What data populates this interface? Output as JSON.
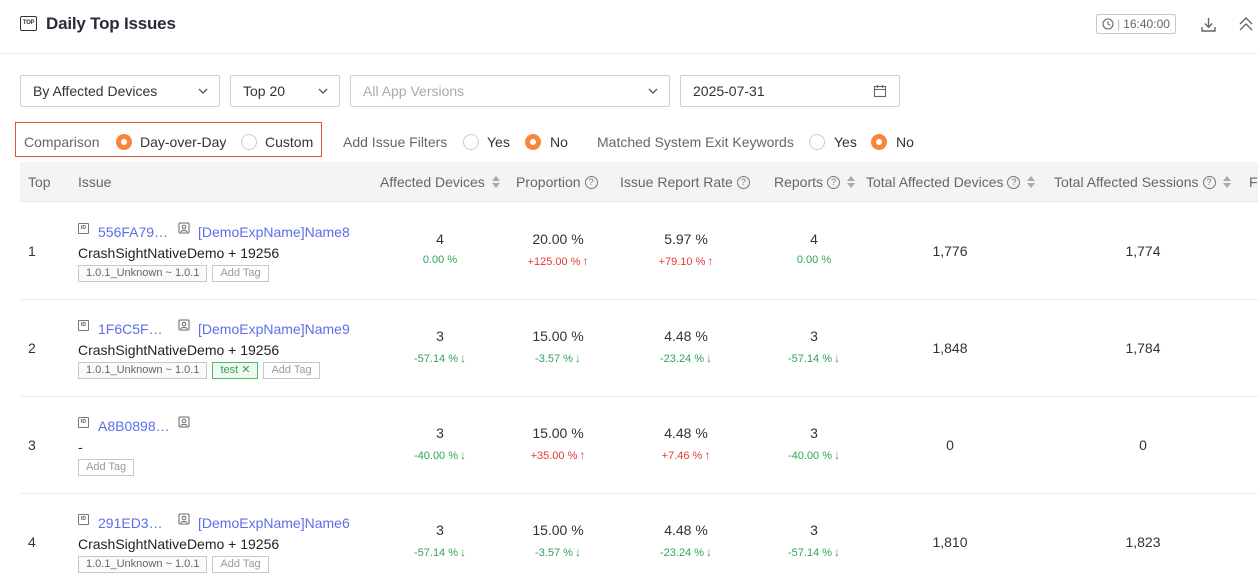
{
  "header": {
    "title": "Daily Top Issues",
    "time": "16:40:00",
    "icons": [
      "top-icon",
      "history-icon",
      "download-icon",
      "collapse-icon"
    ]
  },
  "filters": {
    "sort_by": "By Affected Devices",
    "top_n": "Top 20",
    "versions_placeholder": "All App Versions",
    "date": "2025-07-31"
  },
  "options": {
    "comparison_label": "Comparison",
    "day_over_day": "Day-over-Day",
    "custom": "Custom",
    "add_filters_label": "Add Issue Filters",
    "matched_label": "Matched System Exit Keywords",
    "yes": "Yes",
    "no": "No",
    "comparison_selected": "Day-over-Day",
    "add_filters_selected": "No",
    "matched_selected": "No"
  },
  "colors": {
    "accent": "#f6863b",
    "link": "#5c6ee8",
    "up": "#e53935",
    "down": "#2ea55a",
    "highlight_border": "#e0542f"
  },
  "table": {
    "columns": [
      "Top",
      "Issue",
      "Affected Devices",
      "Proportion",
      "Issue Report Rate",
      "Reports",
      "Total Affected Devices",
      "Total Affected Sessions",
      "F"
    ],
    "rows": [
      {
        "rank": "1",
        "issue_id": "556FA79…",
        "exp_name": "[DemoExpName]Name8",
        "sub": "CrashSightNativeDemo + 19256",
        "tags": [
          "1.0.1_Unknown ~ 1.0.1"
        ],
        "green_tag": "",
        "add_tag": "Add Tag",
        "affected": "4",
        "affected_delta": "0.00 %",
        "affected_trend": "flat",
        "proportion": "20.00 %",
        "proportion_delta": "+125.00 %",
        "proportion_trend": "up",
        "rate": "5.97 %",
        "rate_delta": "+79.10 %",
        "rate_trend": "up",
        "reports": "4",
        "reports_delta": "0.00 %",
        "reports_trend": "flat",
        "total_devices": "1,776",
        "total_sessions": "1,774"
      },
      {
        "rank": "2",
        "issue_id": "1F6C5F…",
        "exp_name": "[DemoExpName]Name9",
        "sub": "CrashSightNativeDemo + 19256",
        "tags": [
          "1.0.1_Unknown ~ 1.0.1"
        ],
        "green_tag": "test",
        "add_tag": "Add Tag",
        "affected": "3",
        "affected_delta": "-57.14 %",
        "affected_trend": "down",
        "proportion": "15.00 %",
        "proportion_delta": "-3.57 %",
        "proportion_trend": "down",
        "rate": "4.48 %",
        "rate_delta": "-23.24 %",
        "rate_trend": "down",
        "reports": "3",
        "reports_delta": "-57.14 %",
        "reports_trend": "down",
        "total_devices": "1,848",
        "total_sessions": "1,784"
      },
      {
        "rank": "3",
        "issue_id": "A8B0898…",
        "exp_name": "",
        "sub": "-",
        "tags": [],
        "green_tag": "",
        "add_tag": "Add Tag",
        "affected": "3",
        "affected_delta": "-40.00 %",
        "affected_trend": "down",
        "proportion": "15.00 %",
        "proportion_delta": "+35.00 %",
        "proportion_trend": "up",
        "rate": "4.48 %",
        "rate_delta": "+7.46 %",
        "rate_trend": "up",
        "reports": "3",
        "reports_delta": "-40.00 %",
        "reports_trend": "down",
        "total_devices": "0",
        "total_sessions": "0"
      },
      {
        "rank": "4",
        "issue_id": "291ED3…",
        "exp_name": "[DemoExpName]Name6",
        "sub": "CrashSightNativeDemo + 19256",
        "tags": [
          "1.0.1_Unknown ~ 1.0.1"
        ],
        "green_tag": "",
        "add_tag": "Add Tag",
        "affected": "3",
        "affected_delta": "-57.14 %",
        "affected_trend": "down",
        "proportion": "15.00 %",
        "proportion_delta": "-3.57 %",
        "proportion_trend": "down",
        "rate": "4.48 %",
        "rate_delta": "-23.24 %",
        "rate_trend": "down",
        "reports": "3",
        "reports_delta": "-57.14 %",
        "reports_trend": "down",
        "total_devices": "1,810",
        "total_sessions": "1,823"
      }
    ]
  }
}
